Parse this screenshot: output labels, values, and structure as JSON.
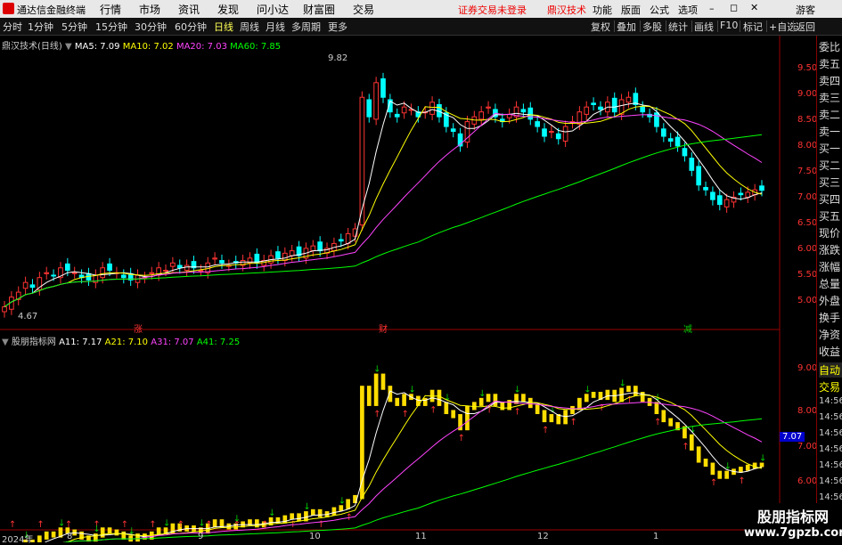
{
  "titlebar": {
    "app_title": "通达信金融终端",
    "menu": [
      "行情",
      "市场",
      "资讯",
      "发现",
      "问小达",
      "财富圈",
      "交易"
    ],
    "notice": "证券交易未登录",
    "stock_name": "鼎汉技术",
    "right_menu": [
      "功能",
      "版面",
      "公式",
      "选项"
    ],
    "user": "游客"
  },
  "toolbar": {
    "periods": [
      "分时",
      "1分钟",
      "5分钟",
      "15分钟",
      "30分钟",
      "60分钟",
      "日线",
      "周线",
      "月线",
      "多周期",
      "更多"
    ],
    "active_period": "日线",
    "right_buttons": [
      "复权",
      "叠加",
      "多股",
      "统计",
      "画线",
      "F10",
      "标记",
      "+自选",
      "返回"
    ]
  },
  "main_legend": {
    "name": "鼎汉技术(日线)",
    "items": [
      {
        "label": "MA5: 7.09",
        "color": "#ffffff"
      },
      {
        "label": "MA10: 7.02",
        "color": "#ffff00"
      },
      {
        "label": "MA20: 7.03",
        "color": "#ff44ff"
      },
      {
        "label": "MA60: 7.85",
        "color": "#00ff00"
      }
    ]
  },
  "sub_legend": {
    "name": "股朋指标网",
    "items": [
      {
        "label": "A11: 7.17",
        "color": "#ffffff"
      },
      {
        "label": "A21: 7.10",
        "color": "#ffff00"
      },
      {
        "label": "A31: 7.07",
        "color": "#ff44ff"
      },
      {
        "label": "A41: 7.25",
        "color": "#00ff00"
      }
    ]
  },
  "annotations": {
    "high": "9.82",
    "low": "4.67"
  },
  "event_markers": [
    "涨",
    "财",
    "减"
  ],
  "main_axis_ticks": [
    "9.50",
    "9.00",
    "8.50",
    "8.00",
    "7.50",
    "7.00",
    "6.50",
    "6.00",
    "5.50",
    "5.00"
  ],
  "sub_axis_ticks": [
    "9.00",
    "8.00",
    "7.00",
    "6.00"
  ],
  "sub_current_value": "7.07",
  "x_axis_labels": [
    "2024年",
    "8",
    "9",
    "10",
    "11",
    "12",
    "1"
  ],
  "side_panel": [
    "委比",
    "卖五",
    "卖四",
    "卖三",
    "卖二",
    "卖一",
    "买一",
    "买二",
    "买三",
    "买四",
    "买五",
    "现价",
    "涨跌",
    "涨幅",
    "总量",
    "外盘",
    "换手",
    "净资",
    "收益",
    "自动",
    "交易"
  ],
  "side_times": [
    "14:56",
    "14:56",
    "14:56",
    "14:56",
    "14:56",
    "14:56",
    "14:56",
    "14:56"
  ],
  "watermark": {
    "line1": "股朋指标网",
    "line2": "www.7gpzb.com"
  },
  "colors": {
    "up": "#ff3333",
    "down": "#00ffff",
    "accent": "#ffff55",
    "red_marker": "#ff3333",
    "green_marker": "#00cc00"
  },
  "chart_data": {
    "type": "candlestick",
    "price_range": [
      4.6,
      9.9
    ],
    "closes": [
      4.7,
      4.9,
      5.0,
      5.2,
      5.1,
      5.3,
      5.4,
      5.35,
      5.5,
      5.45,
      5.4,
      5.3,
      5.25,
      5.35,
      5.5,
      5.45,
      5.4,
      5.3,
      5.25,
      5.35,
      5.3,
      5.4,
      5.5,
      5.45,
      5.6,
      5.5,
      5.55,
      5.5,
      5.45,
      5.6,
      5.7,
      5.6,
      5.55,
      5.6,
      5.65,
      5.7,
      5.6,
      5.65,
      5.75,
      5.7,
      5.8,
      5.85,
      5.75,
      5.9,
      5.95,
      5.85,
      5.9,
      6.0,
      6.05,
      6.2,
      6.3,
      9.0,
      8.6,
      9.3,
      9.0,
      8.7,
      8.6,
      8.8,
      8.75,
      8.6,
      8.7,
      8.9,
      8.6,
      8.4,
      8.3,
      8.0,
      8.5,
      8.6,
      8.7,
      8.8,
      8.6,
      8.5,
      8.65,
      8.8,
      8.7,
      8.55,
      8.4,
      8.2,
      8.3,
      8.15,
      8.4,
      8.5,
      8.7,
      8.8,
      8.85,
      8.75,
      8.9,
      8.7,
      8.95,
      9.0,
      8.85,
      8.7,
      8.6,
      8.4,
      8.2,
      8.1,
      8.0,
      7.8,
      7.5,
      7.2,
      7.1,
      6.9,
      6.8,
      6.9,
      6.95,
      7.0,
      7.05,
      7.1,
      7.09
    ],
    "ma5": 7.09,
    "ma10": 7.02,
    "ma20": 7.03,
    "ma60": 7.85
  }
}
